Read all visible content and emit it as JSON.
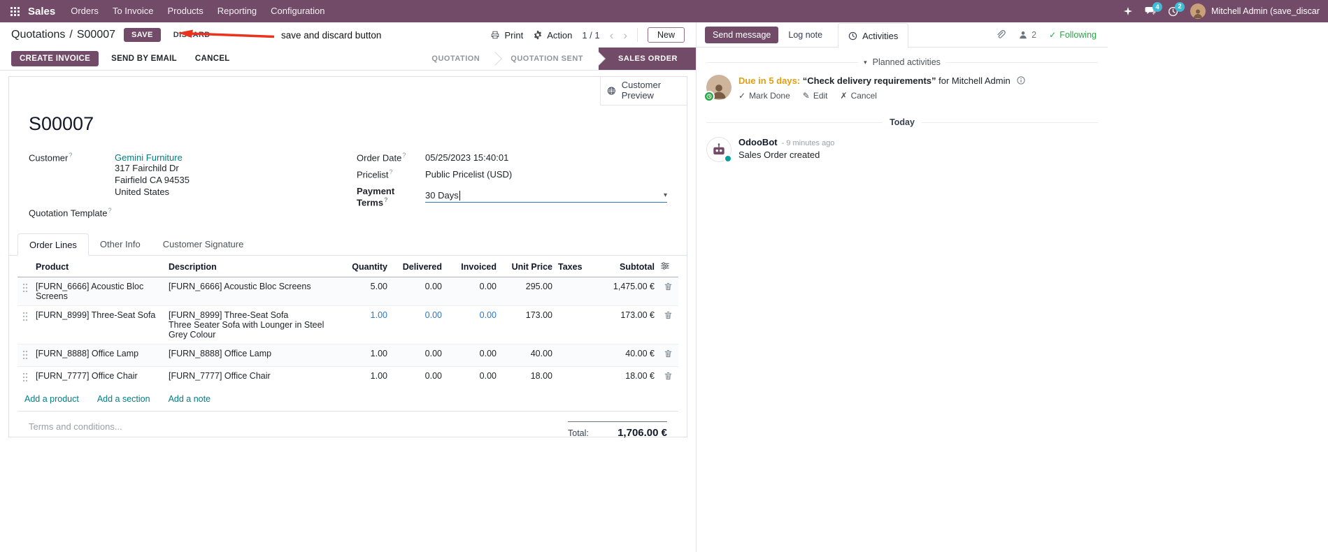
{
  "colors": {
    "primary": "#714B67",
    "link": "#017e84",
    "modified": "#2b77c0",
    "warning": "#e49e0f",
    "badge": "#3fbcd4",
    "success": "#28a745",
    "annotation": "#e9331f"
  },
  "navbar": {
    "app": "Sales",
    "menus": [
      "Orders",
      "To Invoice",
      "Products",
      "Reporting",
      "Configuration"
    ],
    "badges": {
      "messages": "4",
      "activities": "2"
    },
    "user": "Mitchell Admin (save_discar"
  },
  "breadcrumb": {
    "parent": "Quotations",
    "separator": "/",
    "current": "S00007"
  },
  "actions": {
    "save": "SAVE",
    "discard": "DISCARD",
    "print": "Print",
    "action": "Action",
    "pager": "1 / 1",
    "new": "New"
  },
  "annotation": {
    "text": "save and discard button"
  },
  "statusbar": {
    "buttons": [
      "CREATE INVOICE",
      "SEND BY EMAIL",
      "CANCEL"
    ],
    "steps": [
      {
        "label": "QUOTATION",
        "active": false
      },
      {
        "label": "QUOTATION SENT",
        "active": false
      },
      {
        "label": "SALES ORDER",
        "active": true
      }
    ]
  },
  "sheet": {
    "preview_button": "Customer Preview",
    "title": "S00007",
    "help_marker": "?",
    "fields": {
      "customer": {
        "label": "Customer",
        "value": "Gemini Furniture",
        "address": [
          "317 Fairchild Dr",
          "Fairfield CA 94535",
          "United States"
        ]
      },
      "quotation_template": {
        "label": "Quotation Template"
      },
      "order_date": {
        "label": "Order Date",
        "value": "05/25/2023 15:40:01"
      },
      "pricelist": {
        "label": "Pricelist",
        "value": "Public Pricelist (USD)"
      },
      "payment_terms": {
        "label": "Payment Terms",
        "value": "30 Days"
      }
    },
    "tabs": [
      {
        "label": "Order Lines"
      },
      {
        "label": "Other Info"
      },
      {
        "label": "Customer Signature"
      }
    ],
    "table": {
      "headers": [
        "Product",
        "Description",
        "Quantity",
        "Delivered",
        "Invoiced",
        "Unit Price",
        "Taxes",
        "Subtotal"
      ],
      "rows": [
        {
          "product": "[FURN_6666] Acoustic Bloc Screens",
          "description": "[FURN_6666] Acoustic Bloc Screens",
          "description2": "",
          "quantity": "5.00",
          "delivered": "0.00",
          "invoiced": "0.00",
          "unit_price": "295.00",
          "taxes": "",
          "subtotal": "1,475.00 €"
        },
        {
          "product": "[FURN_8999] Three-Seat Sofa",
          "description": "[FURN_8999] Three-Seat Sofa",
          "description2": "Three Seater Sofa with Lounger in Steel Grey Colour",
          "quantity": "1.00",
          "delivered": "0.00",
          "invoiced": "0.00",
          "unit_price": "173.00",
          "taxes": "",
          "subtotal": "173.00 €"
        },
        {
          "product": "[FURN_8888] Office Lamp",
          "description": "[FURN_8888] Office Lamp",
          "description2": "",
          "quantity": "1.00",
          "delivered": "0.00",
          "invoiced": "0.00",
          "unit_price": "40.00",
          "taxes": "",
          "subtotal": "40.00 €"
        },
        {
          "product": "[FURN_7777] Office Chair",
          "description": "[FURN_7777] Office Chair",
          "description2": "",
          "quantity": "1.00",
          "delivered": "0.00",
          "invoiced": "0.00",
          "unit_price": "18.00",
          "taxes": "",
          "subtotal": "18.00 €"
        }
      ],
      "footer_links": [
        "Add a product",
        "Add a section",
        "Add a note"
      ]
    },
    "terms_placeholder": "Terms and conditions...",
    "total_label": "Total:",
    "total_value": "1,706.00 €"
  },
  "chatter": {
    "send_message": "Send message",
    "log_note": "Log note",
    "activities_tab": "Activities",
    "followers_count": "2",
    "following": "Following",
    "planned_header": "Planned activities",
    "activity": {
      "due": "Due in 5 days:",
      "summary": "“Check delivery requirements”",
      "assignee": "for Mitchell Admin",
      "mark_done": "Mark Done",
      "edit": "Edit",
      "cancel": "Cancel"
    },
    "date_divider": "Today",
    "message": {
      "author": "OdooBot",
      "time_sep": "-",
      "time": "9 minutes ago",
      "body": "Sales Order created"
    }
  }
}
